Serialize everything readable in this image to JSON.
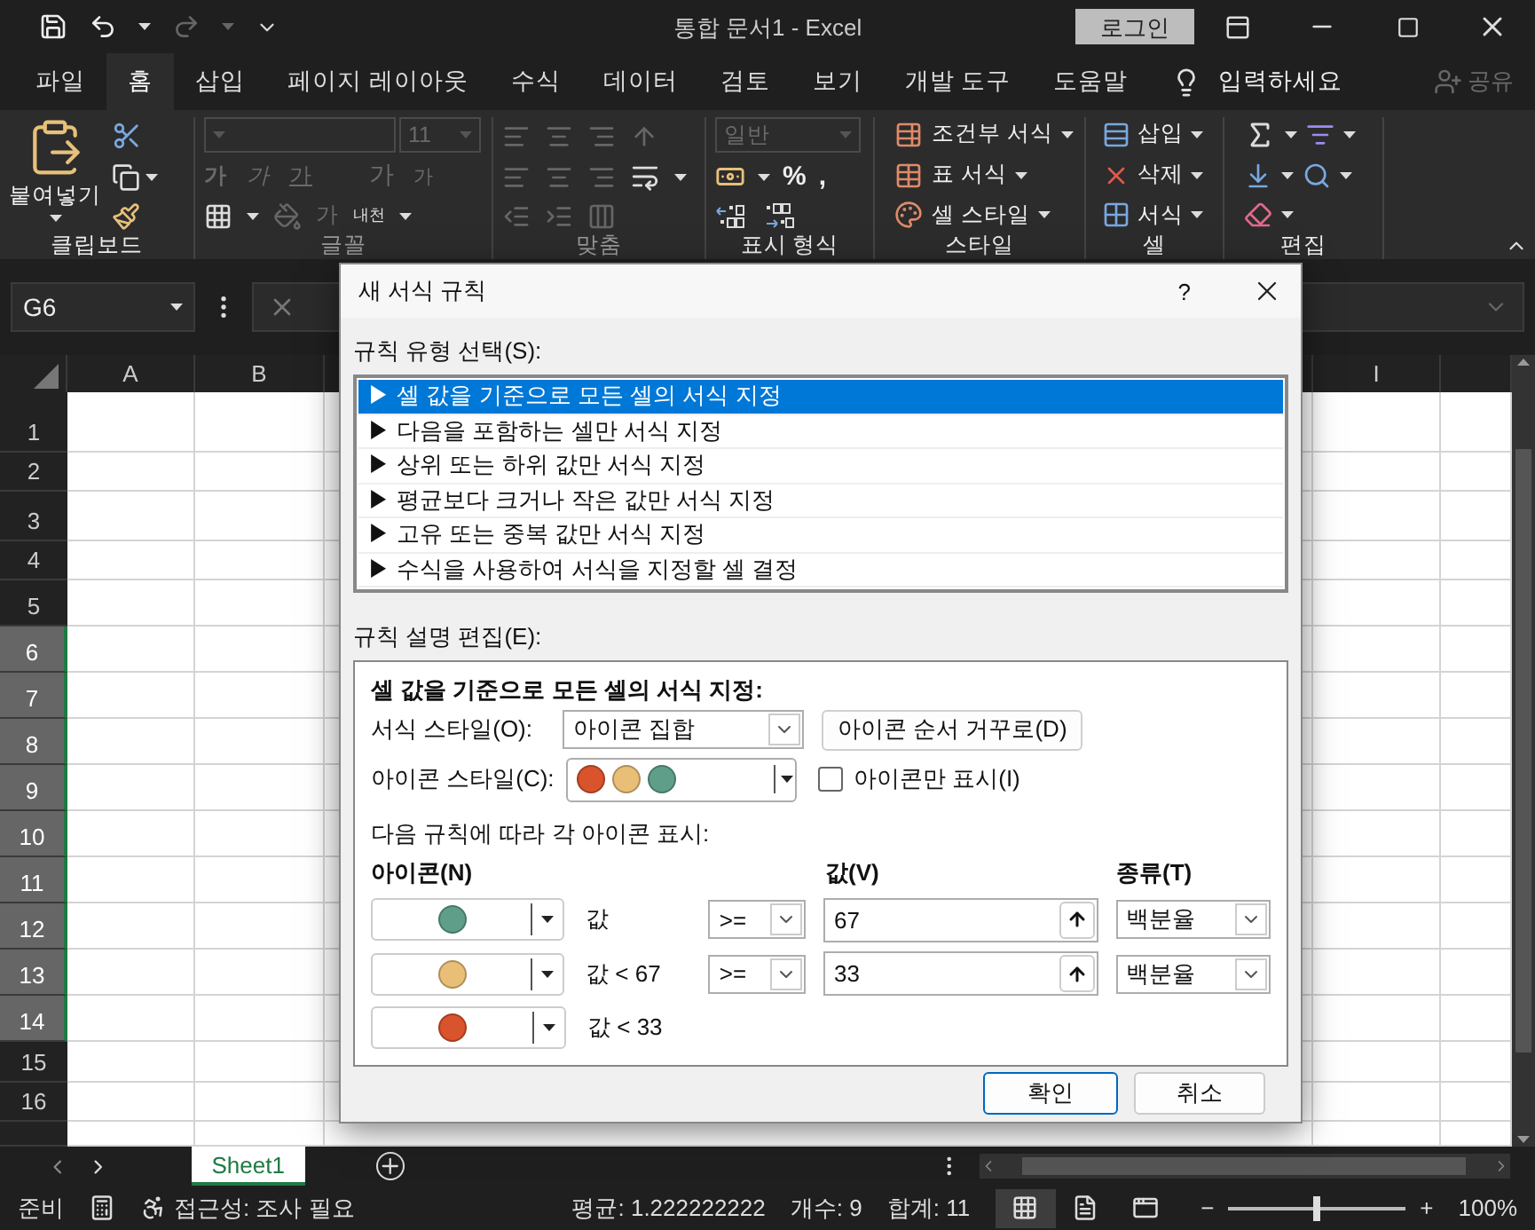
{
  "title_bar": {
    "title": "통합 문서1  -  Excel",
    "login": "로그인"
  },
  "ribbon_tabs": [
    {
      "label": "파일",
      "selected": false
    },
    {
      "label": "홈",
      "selected": true
    },
    {
      "label": "삽입",
      "selected": false
    },
    {
      "label": "페이지 레이아웃",
      "selected": false
    },
    {
      "label": "수식",
      "selected": false
    },
    {
      "label": "데이터",
      "selected": false
    },
    {
      "label": "검토",
      "selected": false
    },
    {
      "label": "보기",
      "selected": false
    },
    {
      "label": "개발 도구",
      "selected": false
    },
    {
      "label": "도움말",
      "selected": false
    }
  ],
  "tell_me": "입력하세요",
  "share": "공유",
  "ribbon_groups": [
    {
      "kind": "clipboard",
      "label": "클립보드",
      "paste": "붙여넣기"
    },
    {
      "kind": "font",
      "label": "글꼴",
      "disabled": true,
      "size": "11",
      "styles": [
        "가",
        "가",
        "가"
      ],
      "grow": [
        "가",
        "가"
      ],
      "color_letter": "가",
      "phonetic": "내천"
    },
    {
      "kind": "alignment",
      "label": "맞춤",
      "disabled": true
    },
    {
      "kind": "number",
      "label": "표시 형식",
      "format": "일반",
      "symbols": [
        "%",
        ","
      ]
    },
    {
      "kind": "styles",
      "label": "스타일",
      "items": [
        "조건부 서식",
        "표 서식",
        "셀 스타일"
      ]
    },
    {
      "kind": "cells",
      "label": "셀",
      "items": [
        "삽입",
        "삭제",
        "서식"
      ]
    },
    {
      "kind": "editing",
      "label": "편집"
    }
  ],
  "name_box": "G6",
  "columns": [
    "A",
    "B",
    "I"
  ],
  "rows": [
    {
      "label": "1",
      "selected": false
    },
    {
      "label": "2",
      "selected": false
    },
    {
      "label": "3",
      "selected": false
    },
    {
      "label": "4",
      "selected": false
    },
    {
      "label": "5",
      "selected": false
    },
    {
      "label": "6",
      "selected": true
    },
    {
      "label": "7",
      "selected": true
    },
    {
      "label": "8",
      "selected": true
    },
    {
      "label": "9",
      "selected": true
    },
    {
      "label": "10",
      "selected": true
    },
    {
      "label": "11",
      "selected": true
    },
    {
      "label": "12",
      "selected": true
    },
    {
      "label": "13",
      "selected": true
    },
    {
      "label": "14",
      "selected": true
    },
    {
      "label": "15",
      "selected": false
    },
    {
      "label": "16",
      "selected": false
    }
  ],
  "sheet_tabs": [
    {
      "label": "Sheet1",
      "selected": true
    }
  ],
  "status_bar": {
    "ready": "준비",
    "accessibility": "접근성: 조사 필요",
    "average": "평균: 1.222222222",
    "count": "개수: 9",
    "sum": "합계: 11",
    "zoom_out": "−",
    "zoom_in": "+",
    "zoom": "100%",
    "zoom_slider": {
      "level": 0.5
    }
  },
  "dialog": {
    "title": "새 서식 규칙",
    "help": "?",
    "type_label": "규칙 유형 선택(S):",
    "rule_types": [
      {
        "label": "▶ 셀 값을 기준으로 모든 셀의 서식 지정",
        "selected": true
      },
      {
        "label": "▶ 다음을 포함하는 셀만 서식 지정",
        "selected": false
      },
      {
        "label": "▶ 상위 또는 하위 값만 서식 지정",
        "selected": false
      },
      {
        "label": "▶ 평균보다 크거나 작은 값만 서식 지정",
        "selected": false
      },
      {
        "label": "▶ 고유 또는 중복 값만 서식 지정",
        "selected": false
      },
      {
        "label": "▶ 수식을 사용하여 서식을 지정할 셀 결정",
        "selected": false
      }
    ],
    "edit_label": "규칙 설명 편집(E):",
    "heading": "셀 값을 기준으로 모든 셀의 서식 지정:",
    "format_style_label": "서식 스타일(O):",
    "format_style": "아이콘 집합",
    "reverse_button": "아이콘 순서 거꾸로(D)",
    "icon_style_label": "아이콘 스타일(C):",
    "icon_style": [
      {
        "color": "#d9532c"
      },
      {
        "color": "#e9bf78"
      },
      {
        "color": "#5f9f8a"
      }
    ],
    "icon_only": {
      "label": "아이콘만 표시(I)",
      "checked": false
    },
    "rules_label": "다음 규칙에 따라 각 아이콘 표시:",
    "col_icon": "아이콘(N)",
    "col_value": "값(V)",
    "col_type": "종류(T)",
    "rules": [
      {
        "kind": "threshold",
        "color": "#5f9f8a",
        "condition": "값",
        "operator": ">=",
        "value": "67",
        "type": "백분율"
      },
      {
        "kind": "threshold",
        "color": "#e9bf78",
        "condition": "값 < 67",
        "operator": ">=",
        "value": "33",
        "type": "백분율"
      },
      {
        "kind": "rest",
        "color": "#d9532c",
        "condition": "값 < 33"
      }
    ],
    "ok": "확인",
    "cancel": "취소"
  }
}
